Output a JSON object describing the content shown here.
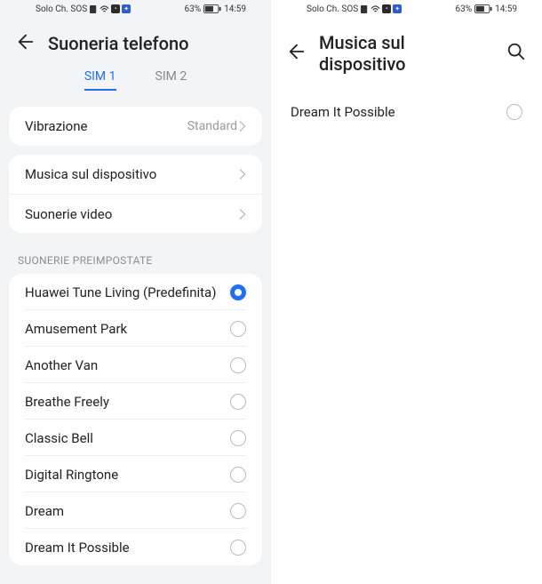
{
  "status": {
    "carrier": "Solo Ch. SOS",
    "battery": "63%",
    "time": "14:59"
  },
  "left": {
    "header": {
      "title": "Suoneria telefono"
    },
    "tabs": [
      {
        "label": "SIM 1",
        "active": true
      },
      {
        "label": "SIM 2",
        "active": false
      }
    ],
    "vibration": {
      "label": "Vibrazione",
      "value": "Standard"
    },
    "sources": [
      {
        "label": "Musica sul dispositivo"
      },
      {
        "label": "Suonerie video"
      }
    ],
    "preset_section": "SUONERIE PREIMPOSTATE",
    "ringtones": [
      {
        "label": "Huawei Tune Living (Predefinita)",
        "selected": true
      },
      {
        "label": "Amusement Park",
        "selected": false
      },
      {
        "label": "Another Van",
        "selected": false
      },
      {
        "label": "Breathe Freely",
        "selected": false
      },
      {
        "label": "Classic Bell",
        "selected": false
      },
      {
        "label": "Digital Ringtone",
        "selected": false
      },
      {
        "label": "Dream",
        "selected": false
      },
      {
        "label": "Dream It Possible",
        "selected": false
      }
    ]
  },
  "right": {
    "header": {
      "title": "Musica sul dispositivo"
    },
    "tracks": [
      {
        "label": "Dream It Possible",
        "selected": false
      }
    ]
  }
}
